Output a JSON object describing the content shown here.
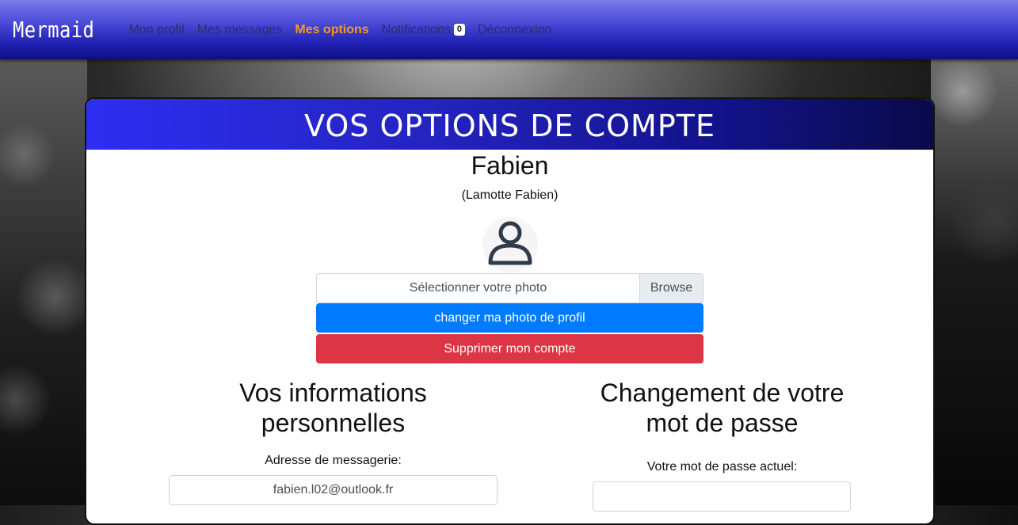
{
  "navbar": {
    "brand": "Mermaid",
    "links": [
      {
        "label": "Mon profil"
      },
      {
        "label": "Mes messages"
      },
      {
        "label": "Mes options"
      },
      {
        "label": "Notifications"
      },
      {
        "label": "Déconnexion"
      }
    ],
    "notifications_count": "0",
    "active_color": "#f39a1d"
  },
  "card": {
    "title": "Vos options de compte",
    "username": "Fabien",
    "fullname": "(Lamotte Fabien)",
    "avatar_icon": "user-icon",
    "file_input": {
      "label": "Sélectionner votre photo",
      "browse": "Browse"
    },
    "change_photo_button": "changer ma photo de profil",
    "delete_account_button": "Supprimer mon compte"
  },
  "personal_info": {
    "title": "Vos informations personnelles",
    "email_label": "Adresse de messagerie:",
    "email_value": "fabien.l02@outlook.fr"
  },
  "password_change": {
    "title": "Changement de votre mot de passe",
    "current_password_label": "Votre mot de passe actuel:",
    "current_password_value": ""
  },
  "colors": {
    "primary": "#007bff",
    "danger": "#dc3545"
  }
}
